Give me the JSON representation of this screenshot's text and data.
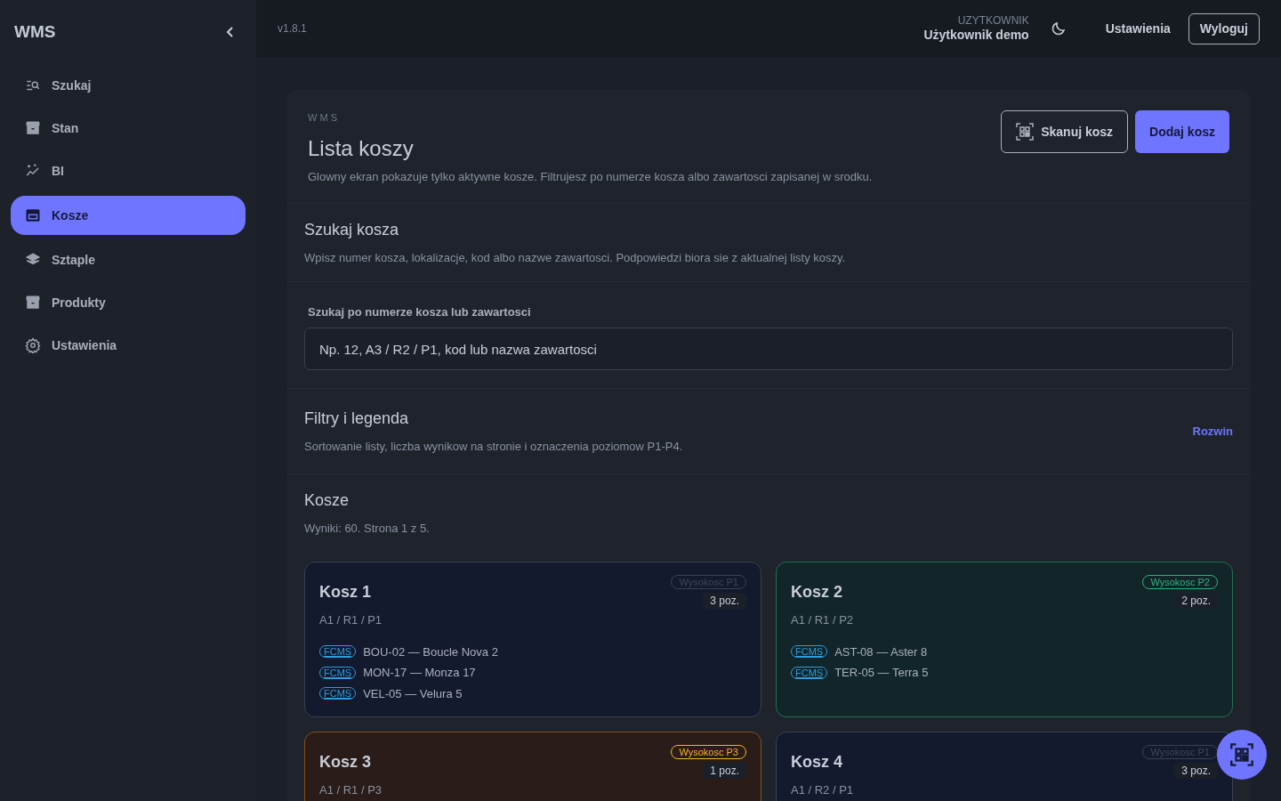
{
  "sidebar": {
    "logo": "WMS",
    "items": [
      {
        "label": "Szukaj",
        "selected": false
      },
      {
        "label": "Stan",
        "selected": false
      },
      {
        "label": "BI",
        "selected": false
      },
      {
        "label": "Kosze",
        "selected": true
      },
      {
        "label": "Sztaple",
        "selected": false
      },
      {
        "label": "Produkty",
        "selected": false
      },
      {
        "label": "Ustawienia",
        "selected": false
      }
    ]
  },
  "header": {
    "version": "v1.8.1",
    "user_caption": "UZYTKOWNIK",
    "user_name": "Użytkownik demo",
    "settings_link": "Ustawienia",
    "logout_button": "Wyloguj"
  },
  "page": {
    "eyebrow": "W M S",
    "title": "Lista koszy",
    "description": "Glowny ekran pokazuje tylko aktywne kosze. Filtrujesz po numerze kosza albo zawartosci zapisanej w srodku.",
    "scan_button": "Skanuj kosz",
    "add_button": "Dodaj kosz"
  },
  "search_section": {
    "title": "Szukaj kosza",
    "description": "Wpisz numer kosza, lokalizacje, kod albo nazwe zawartosci. Podpowiedzi biora sie z aktualnej listy koszy.",
    "field_label": "Szukaj po numerze kosza lub zawartosci",
    "placeholder": "Np. 12, A3 / R2 / P1, kod lub nazwa zawartosci"
  },
  "filters_section": {
    "title": "Filtry i legenda",
    "description": "Sortowanie listy, liczba wynikow na stronie i oznaczenia poziomow P1-P4.",
    "toggle": "Rozwin"
  },
  "results": {
    "title": "Kosze",
    "summary": "Wyniki: 60. Strona 1 z 5.",
    "bins": [
      {
        "name": "Kosz 1",
        "location": "A1 / R1 / P1",
        "kind": "neutral",
        "height_badge": "Wysokosc P1",
        "count": "3 poz.",
        "items": [
          {
            "tag": "FCMS",
            "text": "BOU-02 — Boucle Nova 2"
          },
          {
            "tag": "FCMS",
            "text": "MON-17 — Monza 17"
          },
          {
            "tag": "FCMS",
            "text": "VEL-05 — Velura 5"
          }
        ]
      },
      {
        "name": "Kosz 2",
        "location": "A1 / R1 / P2",
        "kind": "green",
        "height_badge": "Wysokosc P2",
        "count": "2 poz.",
        "items": [
          {
            "tag": "FCMS",
            "text": "AST-08 — Aster 8"
          },
          {
            "tag": "FCMS",
            "text": "TER-05 — Terra 5"
          }
        ]
      },
      {
        "name": "Kosz 3",
        "location": "A1 / R1 / P3",
        "kind": "amber",
        "height_badge": "Wysokosc P3",
        "count": "1 poz."
      },
      {
        "name": "Kosz 4",
        "location": "A1 / R2 / P1",
        "kind": "neutral",
        "height_badge": "Wysokosc P1",
        "count": "3 poz."
      }
    ]
  }
}
